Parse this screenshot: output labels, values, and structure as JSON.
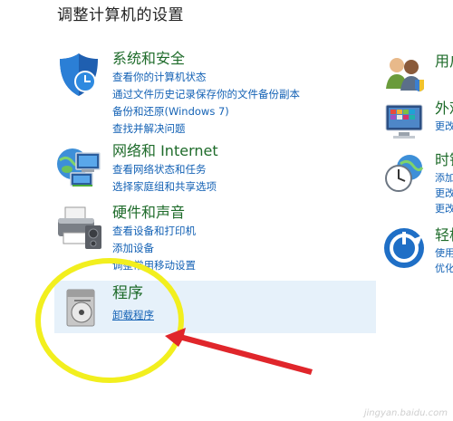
{
  "page_title": "调整计算机的设置",
  "categories": [
    {
      "title": "系统和安全",
      "links": [
        "查看你的计算机状态",
        "通过文件历史记录保存你的文件备份副本",
        "备份和还原(Windows 7)",
        "查找并解决问题"
      ]
    },
    {
      "title": "网络和 Internet",
      "links": [
        "查看网络状态和任务",
        "选择家庭组和共享选项"
      ]
    },
    {
      "title": "硬件和声音",
      "links": [
        "查看设备和打印机",
        "添加设备",
        "调整常用移动设置"
      ]
    },
    {
      "title": "程序",
      "links": [
        "卸载程序"
      ]
    }
  ],
  "right_categories": [
    {
      "title": "用户",
      "links": [
        "",
        ""
      ]
    },
    {
      "title": "外观",
      "links": [
        "更改"
      ]
    },
    {
      "title": "时钟",
      "links": [
        "添加",
        "更改",
        "更改"
      ]
    },
    {
      "title": "轻松",
      "links": [
        "使用",
        "优化"
      ]
    }
  ],
  "icons": {
    "system_security": "shield-icon",
    "network": "network-globe-icon",
    "hardware": "printer-icon",
    "programs": "program-disc-icon",
    "user": "users-icon",
    "appearance": "monitor-icon",
    "clock": "clock-globe-icon",
    "ease": "ease-of-access-icon"
  },
  "colors": {
    "category_title": "#1e6b2a",
    "link": "#1462b5",
    "highlight": "#e6f1fa",
    "annotation_circle": "#f2ef1e",
    "annotation_arrow": "#e0262b"
  },
  "watermark": "jingyan.baidu.com"
}
